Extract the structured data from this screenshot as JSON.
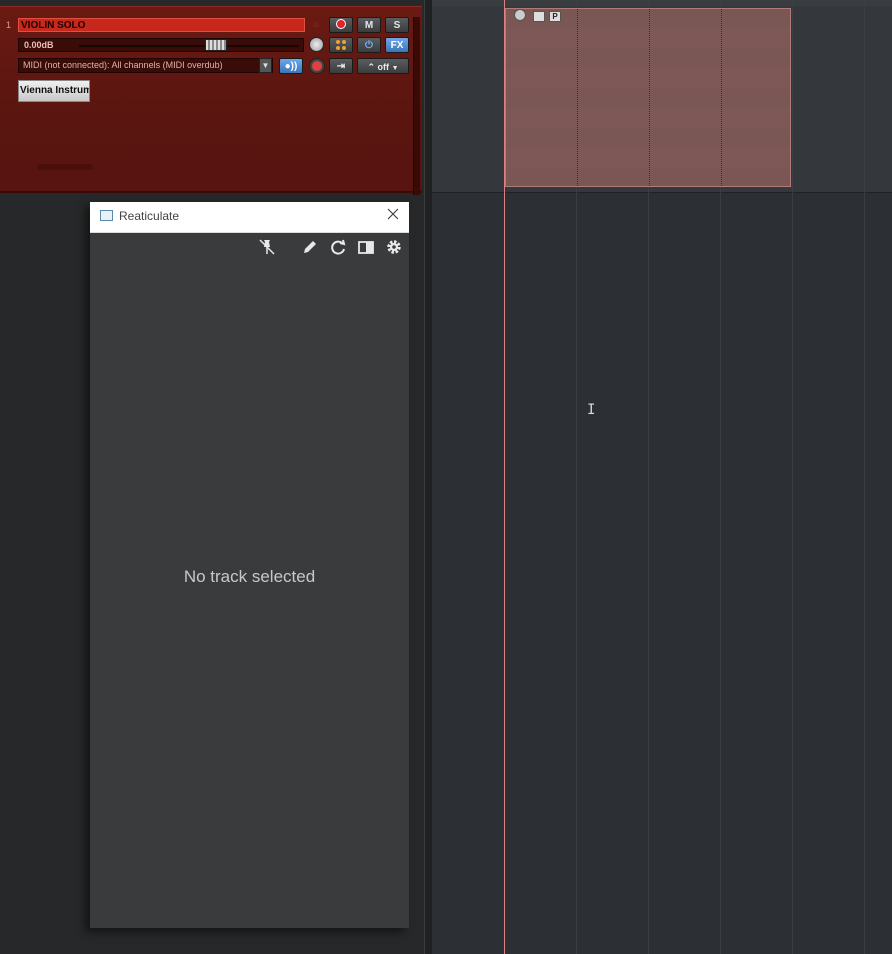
{
  "track": {
    "number": "1",
    "name": "VIOLIN SOLO",
    "volume": "0.00dB",
    "volume_fraction": 0.7,
    "input": "MIDI (not connected): All channels (MIDI overdub)",
    "mute_label": "M",
    "solo_label": "S",
    "fx_label": "FX",
    "automation_mode": "off",
    "plugin_button": "Vienna Instrume"
  },
  "reaticulate": {
    "title": "Reaticulate",
    "empty_message": "No track selected",
    "toolbar": [
      "pin-icon",
      "pencil-icon",
      "refresh-icon",
      "panel-icon",
      "gear-icon"
    ]
  },
  "colors": {
    "track_header": "#5a1510",
    "track_name_bg": "#c8271c",
    "midi_item": "#7a5654",
    "edit_cursor": "#e08080",
    "arrange_bg": "#2c3034"
  }
}
